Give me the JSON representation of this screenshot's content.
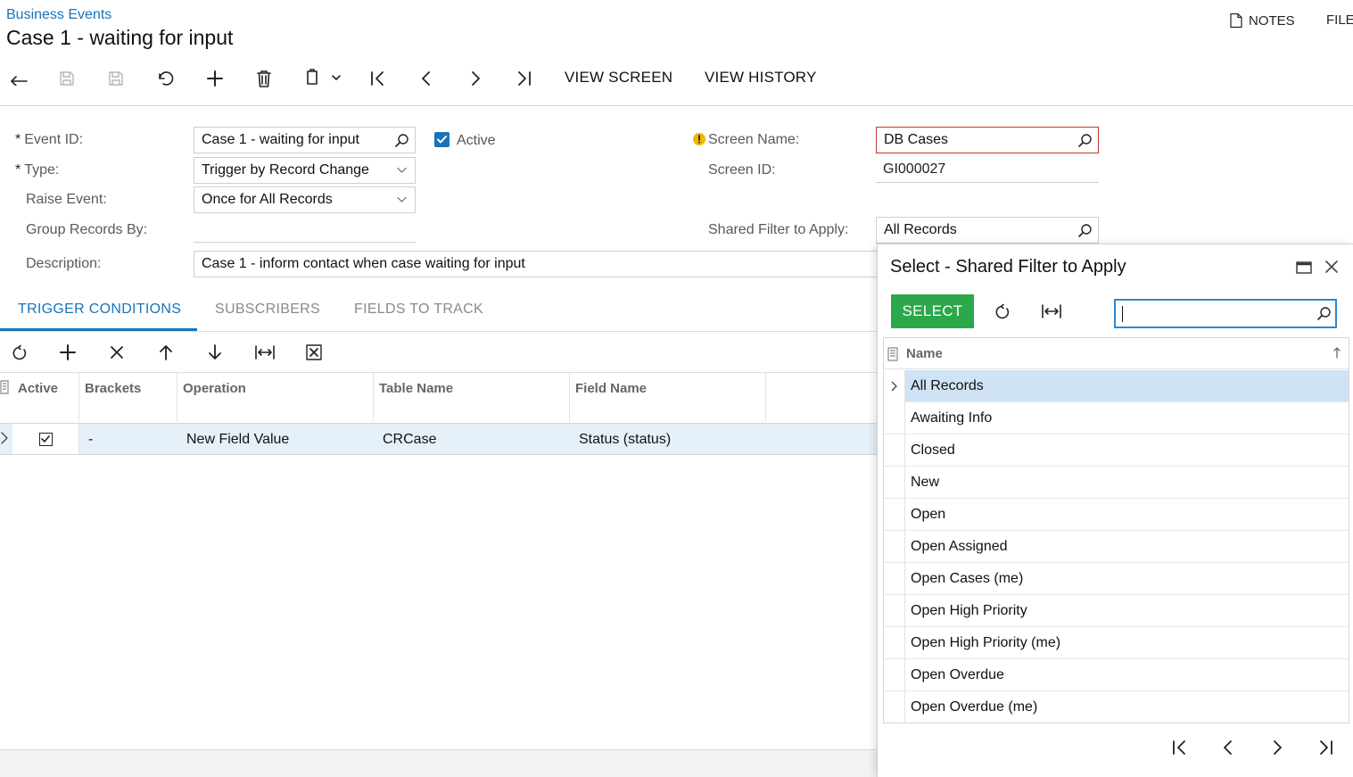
{
  "header": {
    "breadcrumb": "Business Events",
    "title": "Case 1 - waiting for input",
    "notes_label": "NOTES",
    "files_label": "FILE"
  },
  "toolbar": {
    "view_screen_label": "VIEW SCREEN",
    "view_history_label": "VIEW HISTORY"
  },
  "form": {
    "event_id_label": "Event ID:",
    "event_id_value": "Case 1 - waiting for input",
    "type_label": "Type:",
    "type_value": "Trigger by Record Change",
    "raise_event_label": "Raise Event:",
    "raise_event_value": "Once for All Records",
    "group_records_label": "Group Records By:",
    "group_records_value": "",
    "description_label": "Description:",
    "description_value": "Case 1 - inform contact when case waiting for input",
    "active_label": "Active",
    "active_checked": true,
    "screen_name_label": "Screen Name:",
    "screen_name_value": "DB Cases",
    "screen_id_label": "Screen ID:",
    "screen_id_value": "GI000027",
    "shared_filter_label": "Shared Filter to Apply:",
    "shared_filter_value": "All Records",
    "required_marker": "*"
  },
  "tabs": [
    {
      "label": "TRIGGER CONDITIONS",
      "active": true
    },
    {
      "label": "SUBSCRIBERS",
      "active": false
    },
    {
      "label": "FIELDS TO TRACK",
      "active": false
    }
  ],
  "grid": {
    "columns": [
      "Active",
      "Brackets",
      "Operation",
      "Table Name",
      "Field Name"
    ],
    "rows": [
      {
        "active": true,
        "brackets": "-",
        "operation": "New Field Value",
        "table_name": "CRCase",
        "field_name": "Status (status)"
      }
    ]
  },
  "dialog": {
    "title": "Select - Shared Filter to Apply",
    "select_label": "SELECT",
    "search_value": "",
    "column_name": "Name",
    "items": [
      "All Records",
      "Awaiting Info",
      "Closed",
      "New",
      "Open",
      "Open Assigned",
      "Open Cases (me)",
      "Open High Priority",
      "Open High Priority (me)",
      "Open Overdue",
      "Open Overdue (me)"
    ],
    "selected_index": 0
  },
  "colors": {
    "accent": "#1a73b8",
    "select_button": "#2aa84a",
    "selected_row": "#cfe3f5",
    "grid_row": "#e6f0f9",
    "warning": "#f2b705",
    "error_border": "#c0392b"
  },
  "icons": {
    "toolbar": [
      "back-icon",
      "save-close-icon",
      "save-icon",
      "undo-icon",
      "add-icon",
      "delete-icon",
      "copy-paste-icon",
      "first-icon",
      "prev-icon",
      "next-icon",
      "last-icon"
    ],
    "grid_toolbar": [
      "refresh-icon",
      "add-row-icon",
      "delete-row-icon",
      "move-up-icon",
      "move-down-icon",
      "fit-columns-icon",
      "excel-export-icon"
    ],
    "dialog": [
      "maximize-icon",
      "close-icon",
      "refresh-icon",
      "fit-columns-icon",
      "search-icon",
      "sort-asc-icon"
    ]
  }
}
